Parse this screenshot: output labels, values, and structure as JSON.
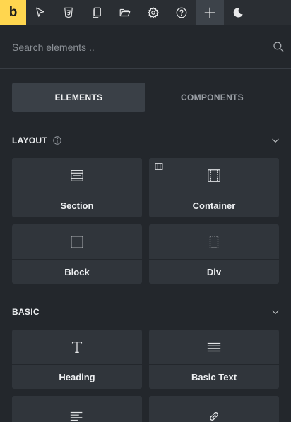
{
  "toolbar": {
    "logo": "b",
    "buttons": [
      {
        "icon": "cursor-arrow-icon"
      },
      {
        "icon": "css3-icon"
      },
      {
        "icon": "pages-icon"
      },
      {
        "icon": "folder-open-icon"
      },
      {
        "icon": "gear-icon"
      },
      {
        "icon": "help-icon"
      },
      {
        "icon": "plus-icon",
        "active": true
      },
      {
        "icon": "moon-icon"
      }
    ]
  },
  "search": {
    "placeholder": "Search elements .."
  },
  "tabs": [
    {
      "label": "ELEMENTS",
      "active": true
    },
    {
      "label": "COMPONENTS",
      "active": false
    }
  ],
  "layout": {
    "title": "LAYOUT",
    "items": [
      {
        "label": "Section",
        "icon": "section-icon"
      },
      {
        "label": "Container",
        "icon": "container-icon"
      },
      {
        "label": "Block",
        "icon": "block-icon"
      },
      {
        "label": "Div",
        "icon": "div-icon"
      }
    ]
  },
  "basic": {
    "title": "BASIC",
    "items": [
      {
        "label": "Heading",
        "icon": "heading-icon"
      },
      {
        "label": "Basic Text",
        "icon": "basic-text-icon"
      },
      {
        "label": "",
        "icon": "rich-text-icon"
      },
      {
        "label": "",
        "icon": "link-icon"
      }
    ]
  },
  "colors": {
    "accent": "#ffd64f",
    "background": "#23272c",
    "card": "#30353b"
  }
}
